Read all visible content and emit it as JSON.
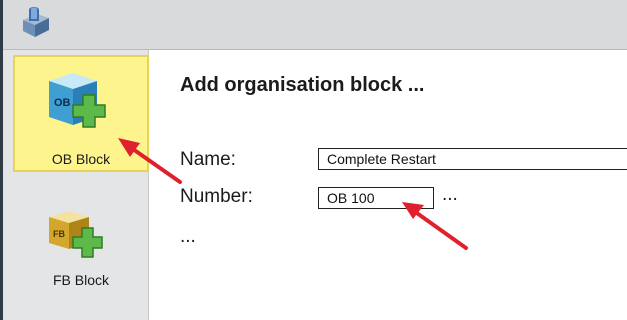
{
  "colors": {
    "accent": "#fdf48e",
    "arrow": "#e0202c",
    "sidebar_bg": "#e4e5e7",
    "topbar_bg": "#d9dadc"
  },
  "sidebar": {
    "items": [
      {
        "label": "OB Block",
        "icon": "ob-block-add-icon",
        "selected": true
      },
      {
        "label": "FB Block",
        "icon": "fb-block-add-icon",
        "selected": false
      }
    ]
  },
  "dialog": {
    "title": "Add organisation block ...",
    "name_label": "Name:",
    "name_value": "Complete Restart",
    "number_label": "Number:",
    "number_value": "OB 100",
    "number_more": "...",
    "more": "..."
  }
}
